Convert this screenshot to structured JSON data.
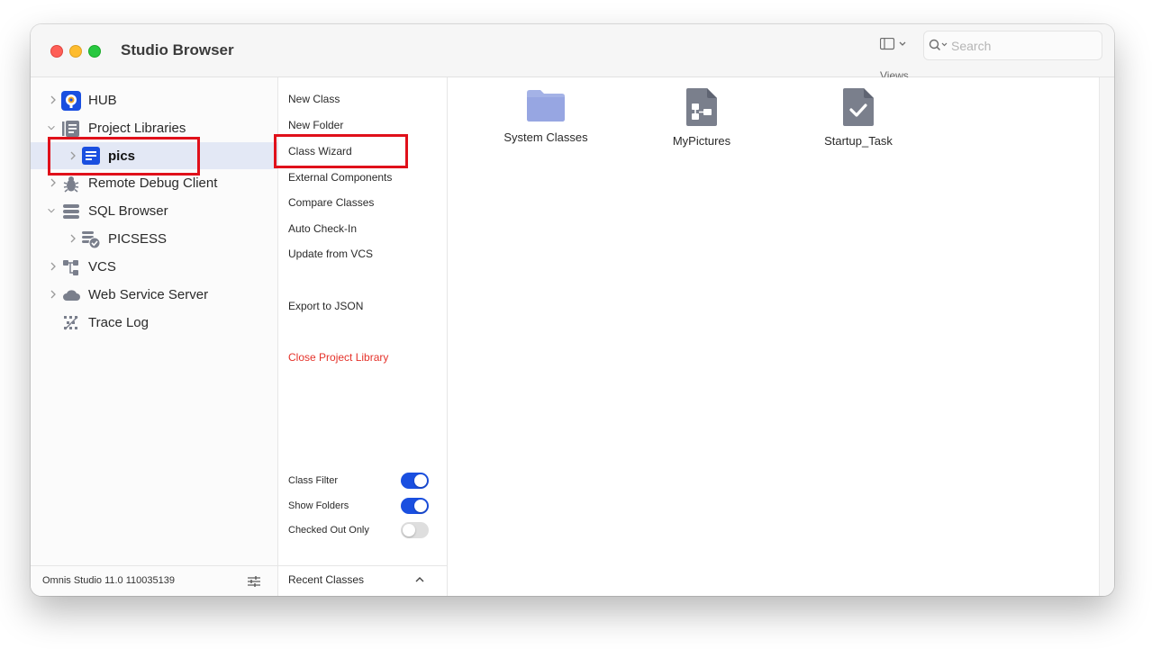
{
  "window": {
    "title": "Studio Browser",
    "views_label": "Views"
  },
  "search": {
    "placeholder": "Search",
    "value": ""
  },
  "tree": {
    "items": [
      {
        "label": "HUB",
        "icon": "hub-icon"
      },
      {
        "label": "Project Libraries",
        "icon": "library-icon"
      },
      {
        "label": "pics",
        "icon": "document-icon"
      },
      {
        "label": "Remote Debug Client",
        "icon": "bug-icon"
      },
      {
        "label": "SQL Browser",
        "icon": "database-icon"
      },
      {
        "label": "PICSESS",
        "icon": "session-icon"
      },
      {
        "label": "VCS",
        "icon": "vcs-icon"
      },
      {
        "label": "Web Service Server",
        "icon": "cloud-icon"
      },
      {
        "label": "Trace Log",
        "icon": "trace-icon"
      }
    ],
    "footer_version": "Omnis Studio 11.0 110035139"
  },
  "actions": {
    "items": [
      "New Class",
      "New Folder",
      "Class Wizard",
      "External Components",
      "Compare Classes",
      "Auto Check-In",
      "Update from VCS",
      "Export to JSON",
      "Close Project Library"
    ],
    "toggles": [
      {
        "label": "Class Filter",
        "on": true
      },
      {
        "label": "Show Folders",
        "on": true
      },
      {
        "label": "Checked Out Only",
        "on": false
      }
    ],
    "recent_label": "Recent Classes"
  },
  "content": {
    "classes": [
      {
        "label": "System Classes",
        "icon": "folder-icon"
      },
      {
        "label": "MyPictures",
        "icon": "flow-document-icon"
      },
      {
        "label": "Startup_Task",
        "icon": "task-document-icon"
      }
    ]
  },
  "colors": {
    "accent": "#1a4fe0",
    "danger": "#e5322a",
    "highlight": "#e0101a"
  }
}
